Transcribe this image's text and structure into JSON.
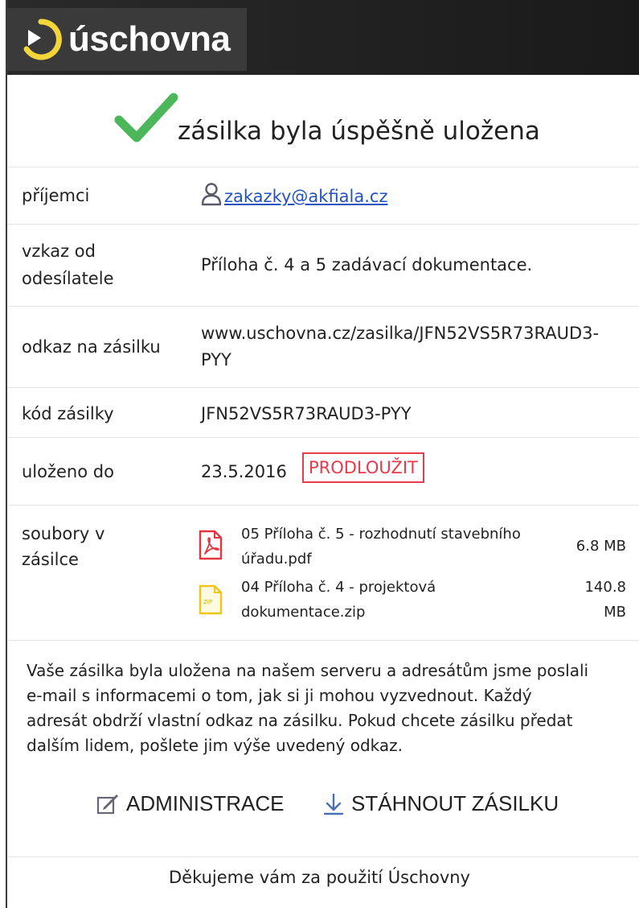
{
  "header": {
    "logo_text": "úschovna",
    "logo_icon": "play-circle-icon"
  },
  "success": {
    "icon": "check-icon",
    "title": "zásilka byla úspěšně uložena"
  },
  "details": {
    "recipients_label": "příjemci",
    "recipients_email": "zakazky@akfiala.cz",
    "message_label_line1": "vzkaz od",
    "message_label_line2": "odesílatele",
    "message_value": "Příloha č. 4 a 5 zadávací dokumentace.",
    "link_label": "odkaz na zásilku",
    "link_line1": "www.uschovna.cz/zasilka/JFN52VS5R73RAUD3-",
    "link_line2": "PYY",
    "code_label": "kód zásilky",
    "code_value": "JFN52VS5R73RAUD3-PYY",
    "stored_label": "uloženo do",
    "stored_value": "23.5.2016",
    "extend_label": "PRODLOUŽIT",
    "files_label_line1": "soubory v",
    "files_label_line2": "zásilce"
  },
  "files": [
    {
      "icon": "pdf-file-icon",
      "name_line1": "05 Příloha č. 5 - rozhodnutí stavebního",
      "name_line2": "úřadu.pdf",
      "size_line1": "6.8 MB",
      "size_line2": ""
    },
    {
      "icon": "zip-file-icon",
      "name_line1": "04 Příloha č. 4 - projektová",
      "name_line2": "dokumentace.zip",
      "size_line1": "140.8",
      "size_line2": "MB"
    }
  ],
  "info": {
    "line1": "Vaše zásilka byla uložena na našem serveru a adresátům jsme poslali",
    "line2": "e-mail s informacemi o tom, jak si ji mohou vyzvednout. Každý",
    "line3": "adresát obdrží vlastní odkaz na zásilku. Pokud chcete zásilku předat",
    "line4": "dalším lidem, pošlete jim výše uvedený odkaz."
  },
  "actions": {
    "admin_label": "ADMINISTRACE",
    "download_label": "STÁHNOUT ZÁSILKU"
  },
  "footer": {
    "thanks": "Děkujeme vám za použití Úschovny"
  },
  "colors": {
    "check": "#4cb75a",
    "link_orange": "#f28a1d",
    "extend_red": "#e73a4b",
    "email_blue": "#2352c4",
    "logo_yellow": "#f3d43b"
  }
}
